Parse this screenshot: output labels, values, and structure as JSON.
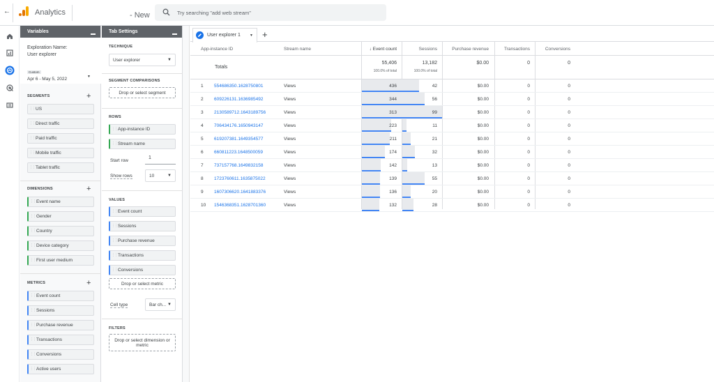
{
  "app": {
    "title": "Analytics",
    "property_suffix": "- New"
  },
  "search": {
    "placeholder": "Try searching \"add web stream\""
  },
  "variables": {
    "header": "Variables",
    "exploration_name_label": "Exploration Name:",
    "exploration_name": "User explorer",
    "date_badge": "Custom",
    "date_range": "Apr 6 - May 5, 2022",
    "segments_label": "SEGMENTS",
    "segments": [
      "US",
      "Direct traffic",
      "Paid traffic",
      "Mobile traffic",
      "Tablet traffic"
    ],
    "dimensions_label": "DIMENSIONS",
    "dimensions": [
      "Event name",
      "Gender",
      "Country",
      "Device category",
      "First user medium"
    ],
    "metrics_label": "METRICS",
    "metrics": [
      "Event count",
      "Sessions",
      "Purchase revenue",
      "Transactions",
      "Conversions",
      "Active users"
    ]
  },
  "tab_settings": {
    "header": "Tab Settings",
    "technique_label": "TECHNIQUE",
    "technique_value": "User explorer",
    "segment_comparisons_label": "SEGMENT COMPARISONS",
    "segment_drop": "Drop or select segment",
    "rows_label": "ROWS",
    "rows": [
      "App-instance ID",
      "Stream name"
    ],
    "start_row_label": "Start row",
    "start_row_value": "1",
    "show_rows_label": "Show rows",
    "show_rows_value": "10",
    "values_label": "VALUES",
    "values": [
      "Event count",
      "Sessions",
      "Purchase revenue",
      "Transactions",
      "Conversions"
    ],
    "metric_drop": "Drop or select metric",
    "cell_type_label": "Cell type",
    "cell_type_value": "Bar ch...",
    "filters_label": "FILTERS",
    "filter_drop": "Drop or select dimension or metric"
  },
  "tabs": [
    {
      "label": "User explorer 1"
    }
  ],
  "table": {
    "columns": [
      "App-instance ID",
      "Stream name",
      "↓ Event count",
      "Sessions",
      "Purchase revenue",
      "Transactions",
      "Conversions"
    ],
    "totals": {
      "label": "Totals",
      "event_count": "55,406",
      "event_pct": "100.0% of total",
      "sessions": "13,182",
      "sessions_pct": "100.0% of total",
      "revenue": "$0.00",
      "transactions": "0",
      "conversions": "0"
    },
    "max_event_count": 436,
    "max_sessions": 99,
    "rows": [
      {
        "n": "1",
        "id": "554686350.1628750801",
        "stream": "Views",
        "events": "436",
        "sessions": "42",
        "revenue": "$0.00",
        "transactions": "0",
        "conversions": "0"
      },
      {
        "n": "2",
        "id": "609226131.1636985492",
        "stream": "Views",
        "events": "344",
        "sessions": "56",
        "revenue": "$0.00",
        "transactions": "0",
        "conversions": "0"
      },
      {
        "n": "3",
        "id": "2130589712.1643189756",
        "stream": "Views",
        "events": "313",
        "sessions": "99",
        "revenue": "$0.00",
        "transactions": "0",
        "conversions": "0"
      },
      {
        "n": "4",
        "id": "706434176.1650943147",
        "stream": "Views",
        "events": "223",
        "sessions": "11",
        "revenue": "$0.00",
        "transactions": "0",
        "conversions": "0"
      },
      {
        "n": "5",
        "id": "619207381.1649354577",
        "stream": "Views",
        "events": "211",
        "sessions": "21",
        "revenue": "$0.00",
        "transactions": "0",
        "conversions": "0"
      },
      {
        "n": "6",
        "id": "660811223.1648500059",
        "stream": "Views",
        "events": "174",
        "sessions": "32",
        "revenue": "$0.00",
        "transactions": "0",
        "conversions": "0"
      },
      {
        "n": "7",
        "id": "737157768.1649832158",
        "stream": "Views",
        "events": "142",
        "sessions": "13",
        "revenue": "$0.00",
        "transactions": "0",
        "conversions": "0"
      },
      {
        "n": "8",
        "id": "1723760611.1635875022",
        "stream": "Views",
        "events": "139",
        "sessions": "55",
        "revenue": "$0.00",
        "transactions": "0",
        "conversions": "0"
      },
      {
        "n": "9",
        "id": "1607306620.1641883376",
        "stream": "Views",
        "events": "136",
        "sessions": "20",
        "revenue": "$0.00",
        "transactions": "0",
        "conversions": "0"
      },
      {
        "n": "10",
        "id": "1546368351.1628701360",
        "stream": "Views",
        "events": "132",
        "sessions": "28",
        "revenue": "$0.00",
        "transactions": "0",
        "conversions": "0"
      }
    ]
  },
  "colors": {
    "accent": "#1a73e8",
    "bar": "#4285f4",
    "logo_orange": "#f9ab00",
    "logo_dark": "#e37400"
  }
}
